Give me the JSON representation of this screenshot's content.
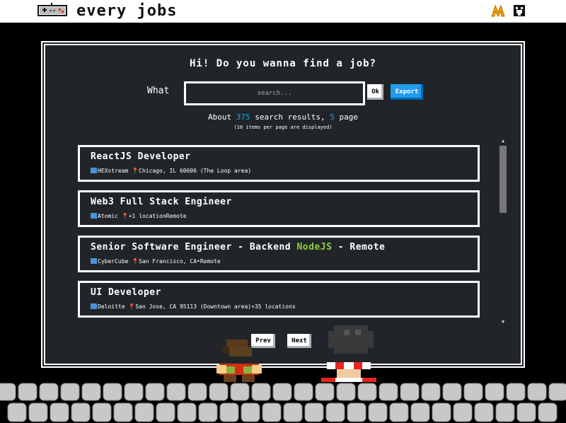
{
  "header": {
    "brand": "every jobs",
    "icons": [
      "gamepad-icon",
      "m-logo-icon",
      "github-icon"
    ]
  },
  "search": {
    "title": "Hi! Do you wanna find a job?",
    "what_label": "What",
    "placeholder": "search...",
    "ok_label": "Ok",
    "export_label": "Export"
  },
  "summary": {
    "about": "About",
    "count": "375",
    "middle": "search results,",
    "pages": "5",
    "suffix": "page",
    "note": "(10 items per page are displayed)"
  },
  "results": [
    {
      "title": "ReactJS Developer",
      "company": "HEXstream",
      "location": "Chicago, IL 60606 (The Loop area)"
    },
    {
      "title": "Web3 Full Stack Engineer",
      "company": "Atomic",
      "location": "+1 locationRemote"
    },
    {
      "title_pre": "Senior Software Engineer - Backend",
      "title_highlight": "NodeJS",
      "title_post": "- Remote",
      "company": "CyberCube",
      "location": "San Francisco, CA•Remote"
    },
    {
      "title": "UI Developer",
      "company": "Deloitte",
      "location": "San Jose, CA 95113 (Downtown area)+35 locations"
    }
  ],
  "pagination": {
    "prev_label": "Prev",
    "next_label": "Next"
  },
  "colors": {
    "panel_bg": "#212529",
    "accent_blue": "#209cee",
    "highlight_green": "#92cc41",
    "header_bg": "#ffffff"
  }
}
